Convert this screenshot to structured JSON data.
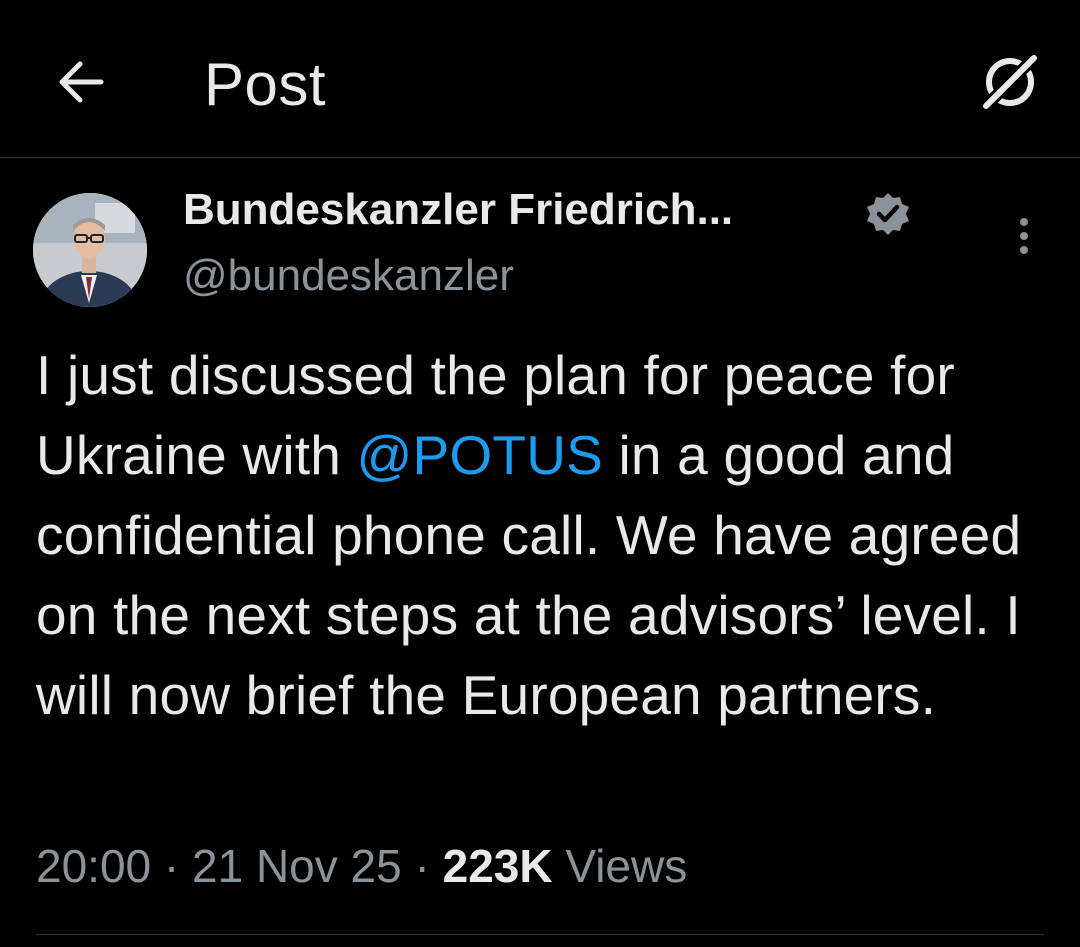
{
  "header": {
    "title": "Post",
    "back_icon": "arrow-left-icon",
    "grok_icon": "grok-icon"
  },
  "author": {
    "name": "Bundeskanzler Friedrich...",
    "handle": "@bundeskanzler",
    "verified_badge_color": "#8b9299"
  },
  "tweet": {
    "text_part1": "I just discussed the plan for peace for Ukraine with ",
    "mention": "@POTUS",
    "text_part2": " in a good and confidential phone call. We have agreed on the next steps at the advisors’ level. I will now brief the European partners."
  },
  "meta": {
    "time": "20:00",
    "sep1": " · ",
    "date": "21 Nov 25",
    "sep2": " · ",
    "views_count": "223K",
    "views_label": " Views"
  },
  "colors": {
    "background": "#000000",
    "text": "#e7e9ea",
    "muted": "#8b9299",
    "accent": "#1d9bf0",
    "divider": "#2f3336"
  }
}
